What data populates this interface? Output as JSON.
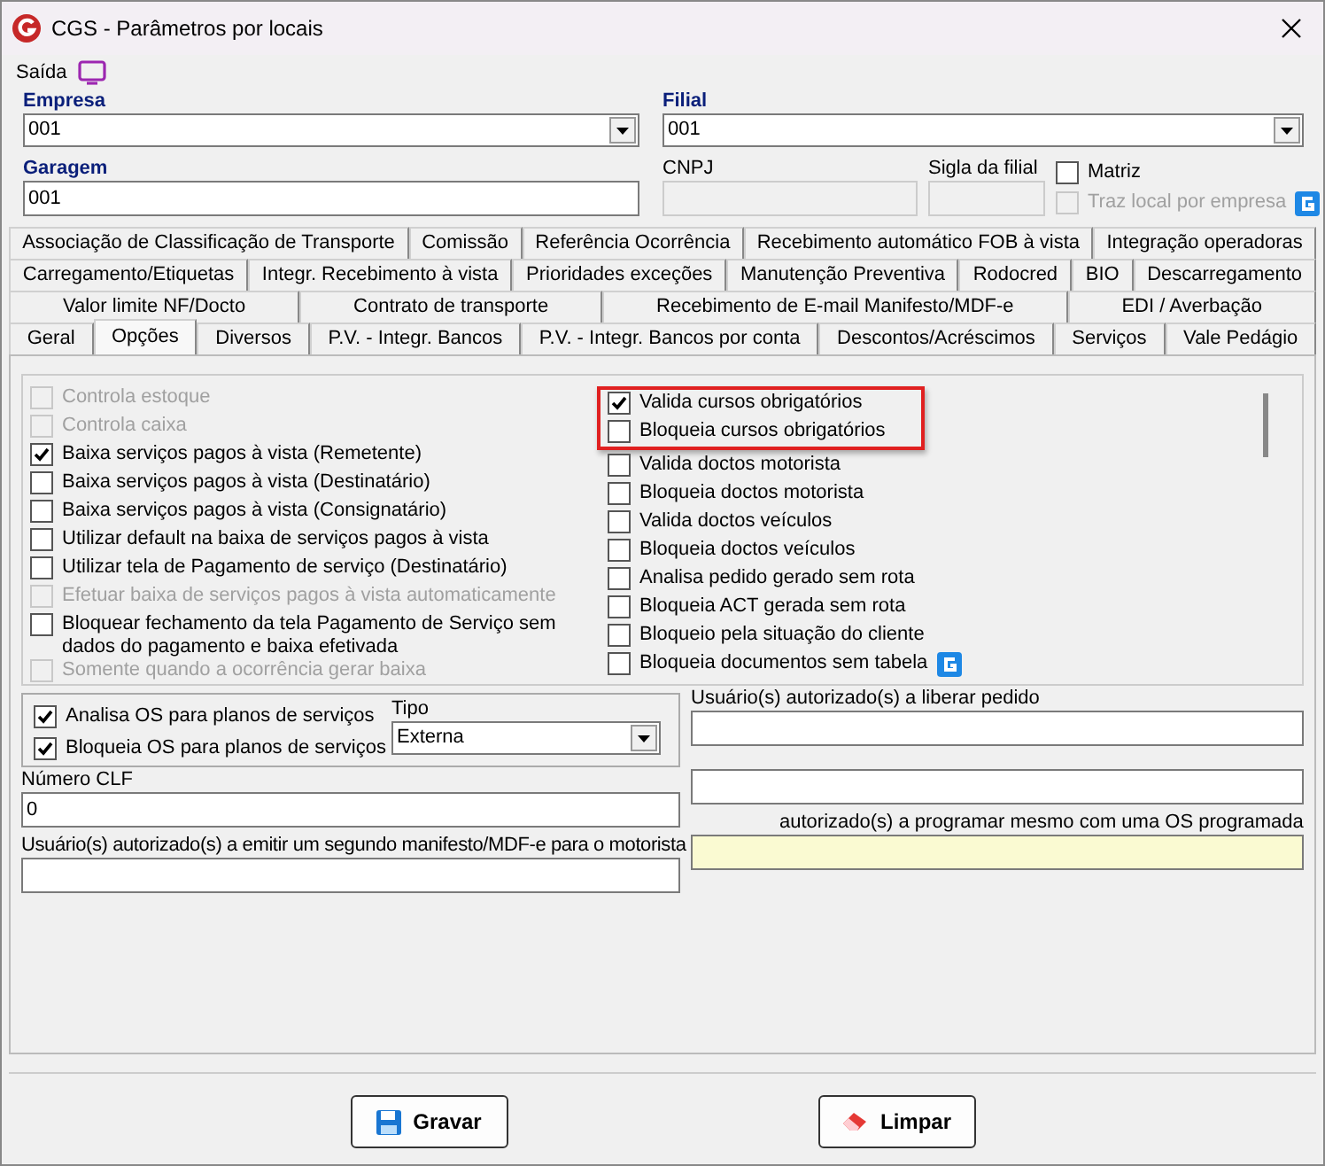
{
  "window": {
    "title": "CGS - Parâmetros por locais"
  },
  "menu": {
    "label": "Saída"
  },
  "empresa": {
    "label": "Empresa",
    "value": "001"
  },
  "filial": {
    "label": "Filial",
    "value": "001"
  },
  "garagem": {
    "label": "Garagem",
    "value": "001"
  },
  "cnpj": {
    "label": "CNPJ"
  },
  "sigla": {
    "label": "Sigla da filial"
  },
  "matriz": {
    "label": "Matriz",
    "checked": false,
    "disabled": false
  },
  "traz_local": {
    "label": "Traz local por empresa",
    "checked": false,
    "disabled": true
  },
  "tab_rows": [
    [
      {
        "label": "Associação de Classificação de Transporte",
        "selected": false
      },
      {
        "label": "Comissão",
        "selected": false
      },
      {
        "label": "Referência Ocorrência",
        "selected": false
      },
      {
        "label": "Recebimento automático FOB à vista",
        "selected": false
      },
      {
        "label": "Integração operadoras",
        "selected": false
      }
    ],
    [
      {
        "label": "Carregamento/Etiquetas",
        "selected": false
      },
      {
        "label": "Integr. Recebimento à vista",
        "selected": false
      },
      {
        "label": "Prioridades exceções",
        "selected": false
      },
      {
        "label": "Manutenção Preventiva",
        "selected": false
      },
      {
        "label": "Rodocred",
        "selected": false
      },
      {
        "label": "BIO",
        "selected": false
      },
      {
        "label": "Descarregamento",
        "selected": false
      }
    ],
    [
      {
        "label": "Valor limite NF/Docto",
        "selected": false
      },
      {
        "label": "Contrato de transporte",
        "selected": false
      },
      {
        "label": "Recebimento de E-mail Manifesto/MDF-e",
        "selected": false
      },
      {
        "label": "EDI / Averbação",
        "selected": false
      }
    ],
    [
      {
        "label": "Geral",
        "selected": false
      },
      {
        "label": "Opções",
        "selected": true
      },
      {
        "label": "Diversos",
        "selected": false
      },
      {
        "label": "P.V. - Integr. Bancos",
        "selected": false
      },
      {
        "label": "P.V. - Integr. Bancos por conta",
        "selected": false
      },
      {
        "label": "Descontos/Acréscimos",
        "selected": false
      },
      {
        "label": "Serviços",
        "selected": false
      },
      {
        "label": "Vale Pedágio",
        "selected": false
      }
    ]
  ],
  "left_options": [
    {
      "label": "Controla estoque",
      "checked": false,
      "disabled": true
    },
    {
      "label": "Controla caixa",
      "checked": false,
      "disabled": true
    },
    {
      "label": "Baixa serviços pagos à vista (Remetente)",
      "checked": true,
      "disabled": false
    },
    {
      "label": "Baixa serviços pagos à vista (Destinatário)",
      "checked": false,
      "disabled": false
    },
    {
      "label": "Baixa serviços pagos à vista (Consignatário)",
      "checked": false,
      "disabled": false
    },
    {
      "label": "Utilizar default na baixa de serviços pagos à vista",
      "checked": false,
      "disabled": false
    },
    {
      "label": "Utilizar tela de Pagamento de serviço (Destinatário)",
      "checked": false,
      "disabled": false
    },
    {
      "label": "Efetuar baixa de serviços pagos à vista automaticamente",
      "checked": false,
      "disabled": true
    },
    {
      "label": "Bloquear fechamento da tela Pagamento de Serviço sem dados do pagamento e baixa efetivada",
      "checked": false,
      "disabled": false
    },
    {
      "label": "Somente quando a ocorrência gerar baixa",
      "checked": false,
      "disabled": true
    }
  ],
  "right_options": [
    {
      "label": "Valida cursos obrigatórios",
      "checked": true,
      "disabled": false,
      "highlighted": true
    },
    {
      "label": "Bloqueia cursos obrigatórios",
      "checked": false,
      "disabled": false,
      "highlighted": true
    },
    {
      "label": "Valida doctos motorista",
      "checked": false,
      "disabled": false,
      "highlighted": false
    },
    {
      "label": "Bloqueia doctos motorista",
      "checked": false,
      "disabled": false,
      "highlighted": false
    },
    {
      "label": "Valida doctos veículos",
      "checked": false,
      "disabled": false,
      "highlighted": false
    },
    {
      "label": "Bloqueia doctos veículos",
      "checked": false,
      "disabled": false,
      "highlighted": false
    },
    {
      "label": "Analisa pedido gerado sem rota",
      "checked": false,
      "disabled": false,
      "highlighted": false
    },
    {
      "label": "Bloqueia ACT gerada sem rota",
      "checked": false,
      "disabled": false,
      "highlighted": false
    },
    {
      "label": "Bloqueio pela situação do cliente",
      "checked": false,
      "disabled": false,
      "highlighted": false
    },
    {
      "label": "Bloqueia documentos sem tabela",
      "checked": false,
      "disabled": false,
      "highlighted": false
    }
  ],
  "os_group": {
    "options": [
      {
        "label": "Analisa OS para planos de serviços",
        "checked": true
      },
      {
        "label": "Bloqueia OS para planos de serviços",
        "checked": true
      }
    ],
    "tipo": {
      "label": "Tipo",
      "value": "Externa"
    }
  },
  "numero_clf": {
    "label": "Número CLF",
    "value": "0"
  },
  "liberar_pedido": {
    "label": "Usuário(s) autorizado(s) a liberar pedido"
  },
  "segundo_manifesto": {
    "label": "Usuário(s) autorizado(s) a emitir um segundo manifesto/MDF-e para o motorista"
  },
  "programar_os": {
    "label": "autorizado(s) a programar mesmo com uma OS programada"
  },
  "buttons": [
    {
      "label": "Gravar",
      "kind": "save"
    },
    {
      "label": "Limpar",
      "kind": "clear"
    }
  ]
}
